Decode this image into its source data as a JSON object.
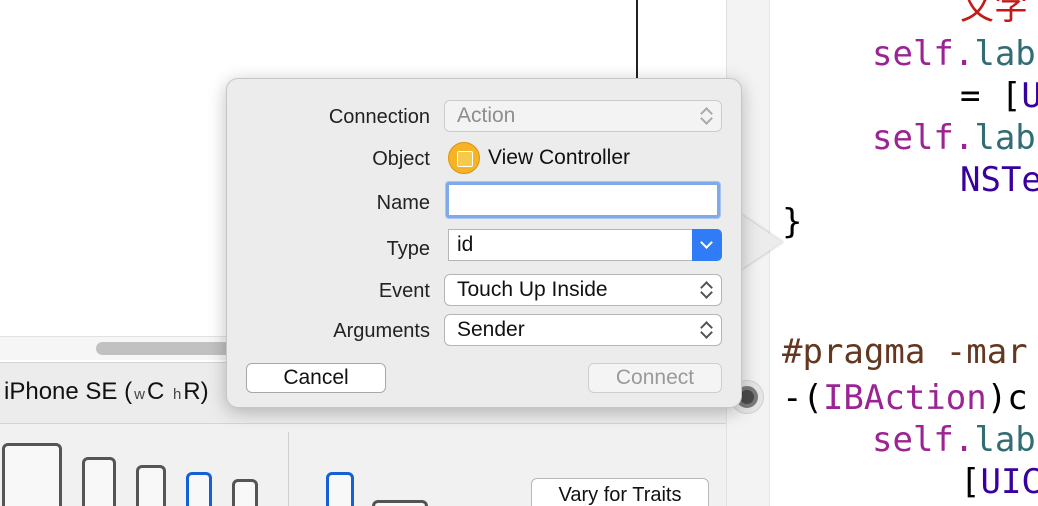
{
  "device_bar": {
    "device_name": "iPhone SE",
    "size_class_open": "(",
    "width_class_prefix": "w",
    "width_class_value": "C",
    "height_class_prefix": "h",
    "height_class_value": "R)",
    "vary_button": "Vary for Traits"
  },
  "popover": {
    "connection": {
      "label": "Connection",
      "value": "Action",
      "enabled": false
    },
    "object": {
      "label": "Object",
      "value": "View Controller",
      "icon": "view-controller-icon"
    },
    "name": {
      "label": "Name",
      "value": ""
    },
    "type": {
      "label": "Type",
      "value": "id"
    },
    "event": {
      "label": "Event",
      "value": "Touch Up Inside"
    },
    "arguments": {
      "label": "Arguments",
      "value": "Sender"
    },
    "cancel_label": "Cancel",
    "connect_label": "Connect"
  },
  "code": {
    "line1": "文字",
    "line2_a": "self.",
    "line2_b": "lab",
    "line3_a": "= [",
    "line3_b": "U",
    "line4_a": "self.",
    "line4_b": "lab",
    "line5": "NSTe",
    "line6": "}",
    "line7": "#pragma -mar",
    "line8_a": "-(",
    "line8_b": "IBAction",
    "line8_c": ")c",
    "line9_a": "self.",
    "line9_b": "lab",
    "line10_a": "[",
    "line10_b": "UIC"
  },
  "colors": {
    "accent": "#2f7cf6",
    "focus_ring": "#7fa9e8",
    "selected_device": "#1560d6",
    "object_icon": "#f5b325"
  }
}
